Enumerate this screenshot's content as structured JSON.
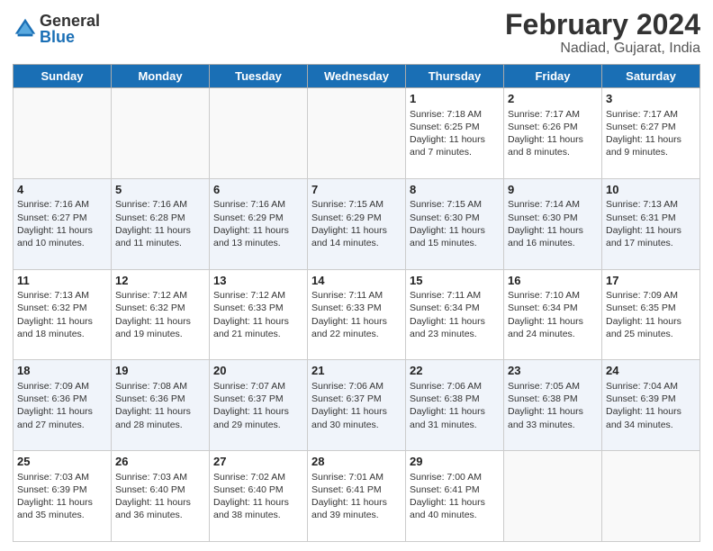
{
  "logo": {
    "general": "General",
    "blue": "Blue"
  },
  "title": "February 2024",
  "location": "Nadiad, Gujarat, India",
  "days_of_week": [
    "Sunday",
    "Monday",
    "Tuesday",
    "Wednesday",
    "Thursday",
    "Friday",
    "Saturday"
  ],
  "weeks": [
    [
      {
        "day": "",
        "info": ""
      },
      {
        "day": "",
        "info": ""
      },
      {
        "day": "",
        "info": ""
      },
      {
        "day": "",
        "info": ""
      },
      {
        "day": "1",
        "info": "Sunrise: 7:18 AM\nSunset: 6:25 PM\nDaylight: 11 hours and 7 minutes."
      },
      {
        "day": "2",
        "info": "Sunrise: 7:17 AM\nSunset: 6:26 PM\nDaylight: 11 hours and 8 minutes."
      },
      {
        "day": "3",
        "info": "Sunrise: 7:17 AM\nSunset: 6:27 PM\nDaylight: 11 hours and 9 minutes."
      }
    ],
    [
      {
        "day": "4",
        "info": "Sunrise: 7:16 AM\nSunset: 6:27 PM\nDaylight: 11 hours and 10 minutes."
      },
      {
        "day": "5",
        "info": "Sunrise: 7:16 AM\nSunset: 6:28 PM\nDaylight: 11 hours and 11 minutes."
      },
      {
        "day": "6",
        "info": "Sunrise: 7:16 AM\nSunset: 6:29 PM\nDaylight: 11 hours and 13 minutes."
      },
      {
        "day": "7",
        "info": "Sunrise: 7:15 AM\nSunset: 6:29 PM\nDaylight: 11 hours and 14 minutes."
      },
      {
        "day": "8",
        "info": "Sunrise: 7:15 AM\nSunset: 6:30 PM\nDaylight: 11 hours and 15 minutes."
      },
      {
        "day": "9",
        "info": "Sunrise: 7:14 AM\nSunset: 6:30 PM\nDaylight: 11 hours and 16 minutes."
      },
      {
        "day": "10",
        "info": "Sunrise: 7:13 AM\nSunset: 6:31 PM\nDaylight: 11 hours and 17 minutes."
      }
    ],
    [
      {
        "day": "11",
        "info": "Sunrise: 7:13 AM\nSunset: 6:32 PM\nDaylight: 11 hours and 18 minutes."
      },
      {
        "day": "12",
        "info": "Sunrise: 7:12 AM\nSunset: 6:32 PM\nDaylight: 11 hours and 19 minutes."
      },
      {
        "day": "13",
        "info": "Sunrise: 7:12 AM\nSunset: 6:33 PM\nDaylight: 11 hours and 21 minutes."
      },
      {
        "day": "14",
        "info": "Sunrise: 7:11 AM\nSunset: 6:33 PM\nDaylight: 11 hours and 22 minutes."
      },
      {
        "day": "15",
        "info": "Sunrise: 7:11 AM\nSunset: 6:34 PM\nDaylight: 11 hours and 23 minutes."
      },
      {
        "day": "16",
        "info": "Sunrise: 7:10 AM\nSunset: 6:34 PM\nDaylight: 11 hours and 24 minutes."
      },
      {
        "day": "17",
        "info": "Sunrise: 7:09 AM\nSunset: 6:35 PM\nDaylight: 11 hours and 25 minutes."
      }
    ],
    [
      {
        "day": "18",
        "info": "Sunrise: 7:09 AM\nSunset: 6:36 PM\nDaylight: 11 hours and 27 minutes."
      },
      {
        "day": "19",
        "info": "Sunrise: 7:08 AM\nSunset: 6:36 PM\nDaylight: 11 hours and 28 minutes."
      },
      {
        "day": "20",
        "info": "Sunrise: 7:07 AM\nSunset: 6:37 PM\nDaylight: 11 hours and 29 minutes."
      },
      {
        "day": "21",
        "info": "Sunrise: 7:06 AM\nSunset: 6:37 PM\nDaylight: 11 hours and 30 minutes."
      },
      {
        "day": "22",
        "info": "Sunrise: 7:06 AM\nSunset: 6:38 PM\nDaylight: 11 hours and 31 minutes."
      },
      {
        "day": "23",
        "info": "Sunrise: 7:05 AM\nSunset: 6:38 PM\nDaylight: 11 hours and 33 minutes."
      },
      {
        "day": "24",
        "info": "Sunrise: 7:04 AM\nSunset: 6:39 PM\nDaylight: 11 hours and 34 minutes."
      }
    ],
    [
      {
        "day": "25",
        "info": "Sunrise: 7:03 AM\nSunset: 6:39 PM\nDaylight: 11 hours and 35 minutes."
      },
      {
        "day": "26",
        "info": "Sunrise: 7:03 AM\nSunset: 6:40 PM\nDaylight: 11 hours and 36 minutes."
      },
      {
        "day": "27",
        "info": "Sunrise: 7:02 AM\nSunset: 6:40 PM\nDaylight: 11 hours and 38 minutes."
      },
      {
        "day": "28",
        "info": "Sunrise: 7:01 AM\nSunset: 6:41 PM\nDaylight: 11 hours and 39 minutes."
      },
      {
        "day": "29",
        "info": "Sunrise: 7:00 AM\nSunset: 6:41 PM\nDaylight: 11 hours and 40 minutes."
      },
      {
        "day": "",
        "info": ""
      },
      {
        "day": "",
        "info": ""
      }
    ]
  ]
}
